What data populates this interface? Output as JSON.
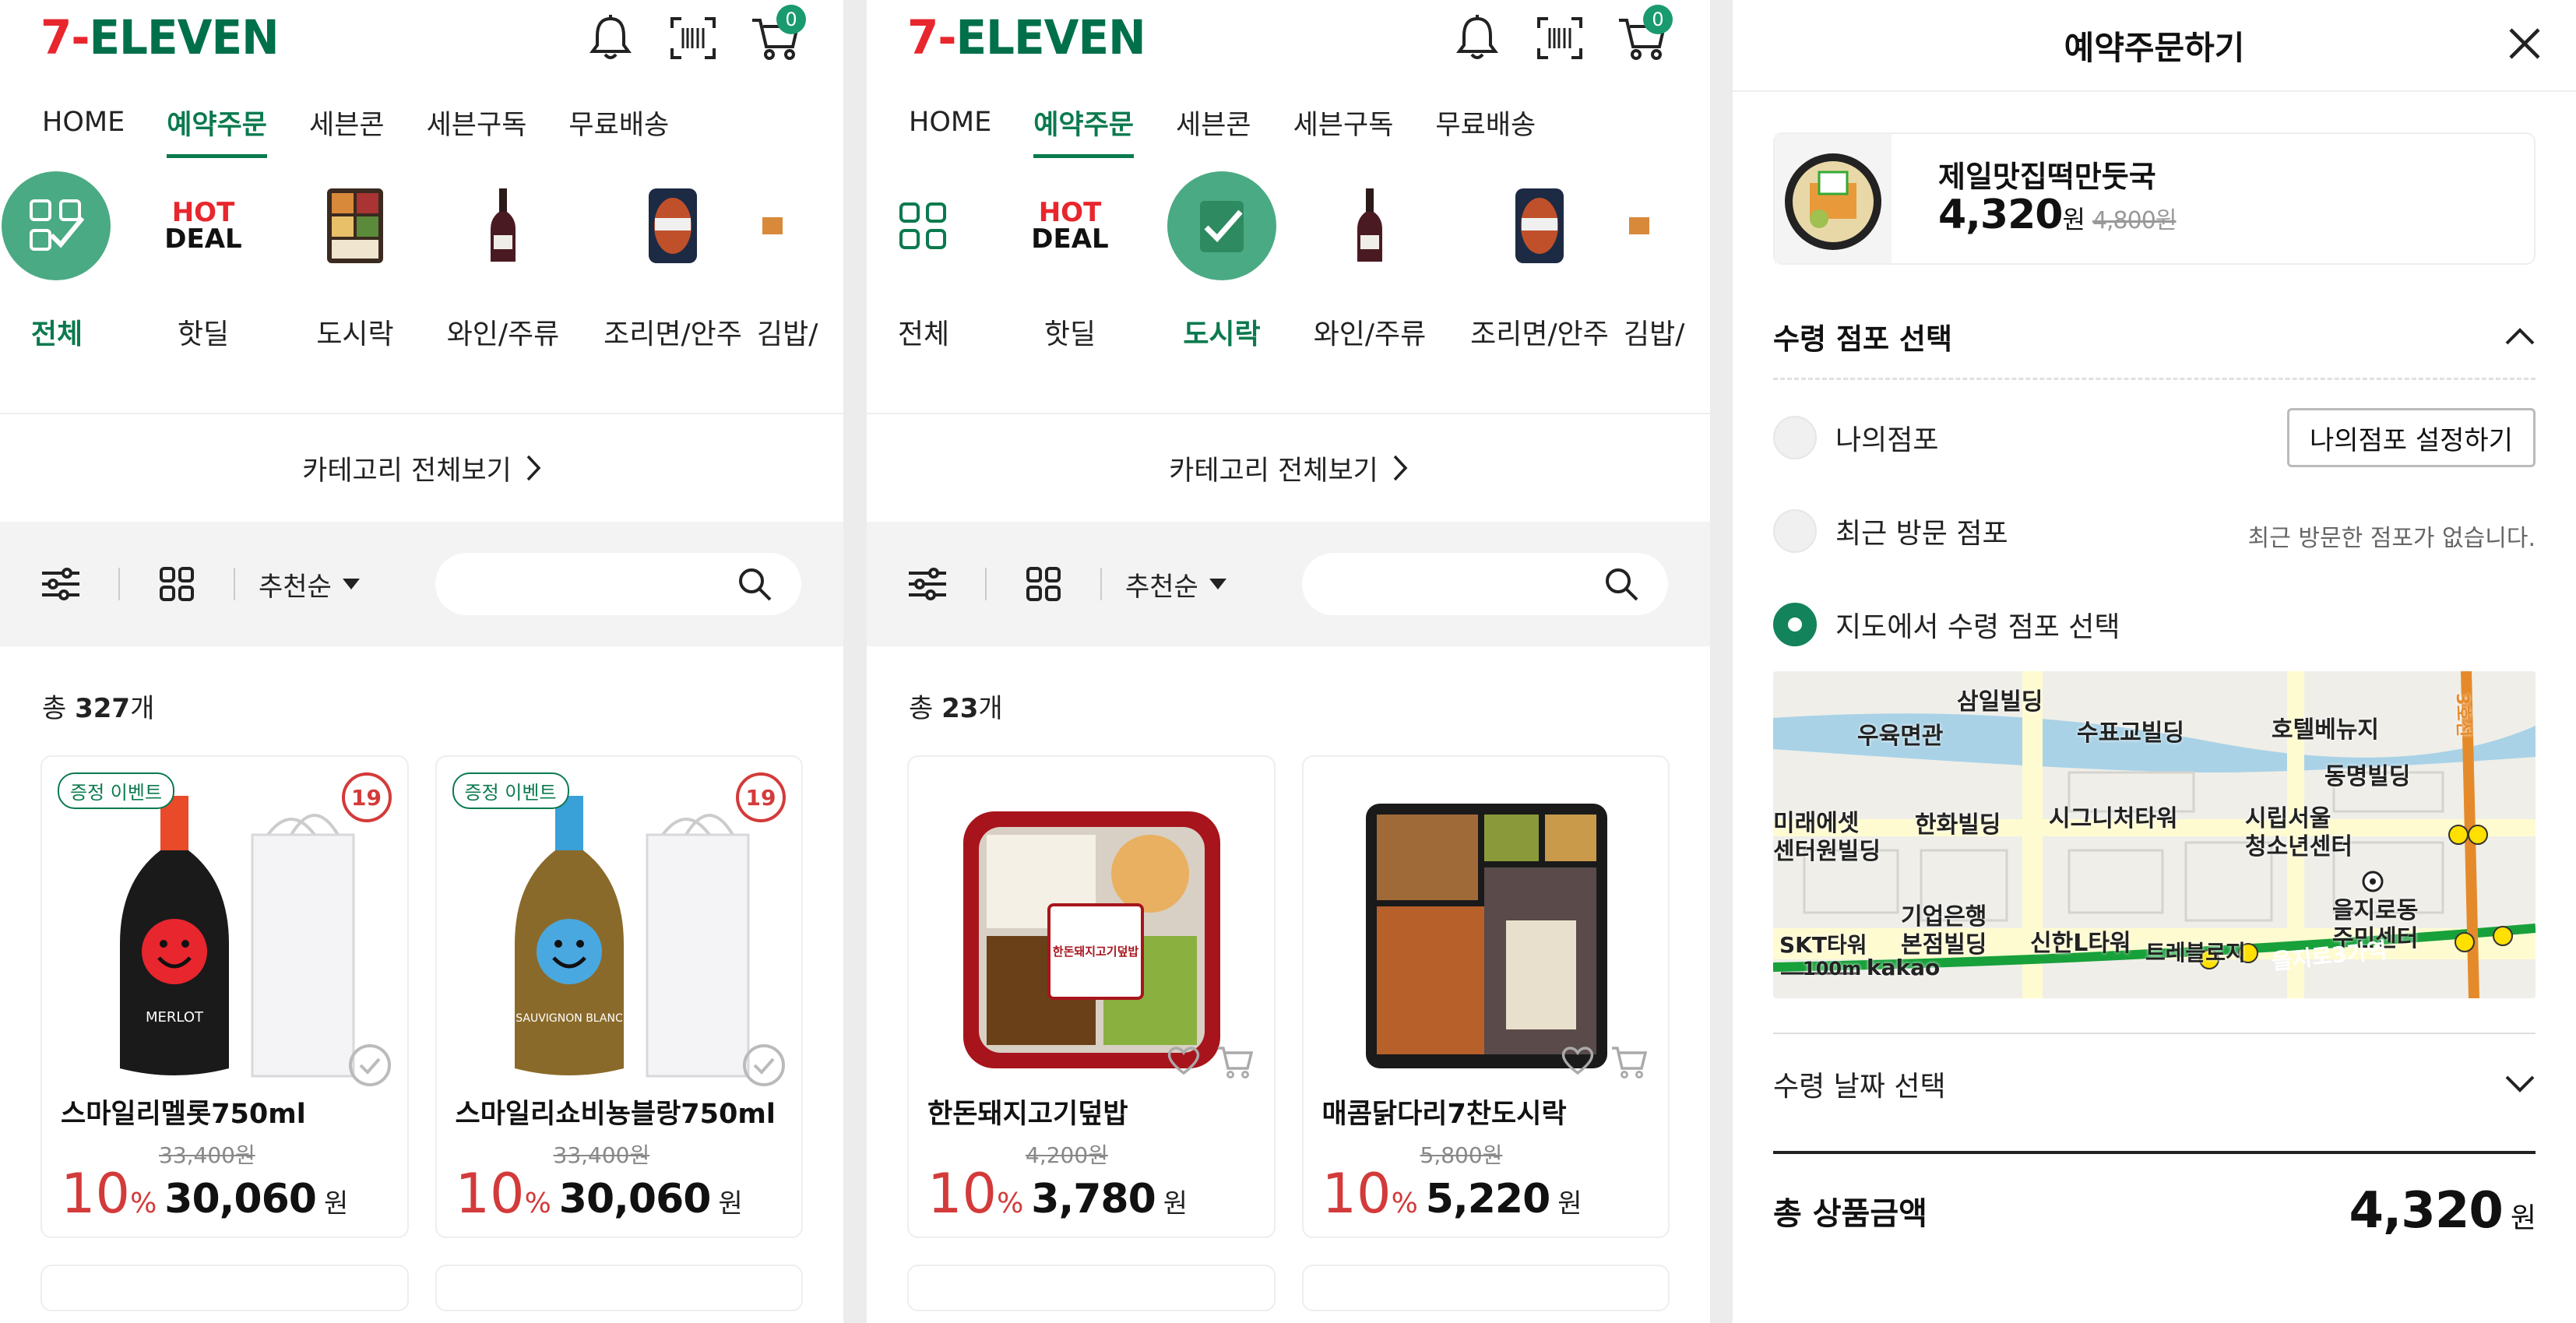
{
  "brand": {
    "logo_num": "7-",
    "logo_word": "ELEVEN",
    "cart_count": "0"
  },
  "nav": [
    "HOME",
    "예약주문",
    "세븐콘",
    "세븐구독",
    "무료배송"
  ],
  "categories": [
    "전체",
    "핫딜",
    "도시락",
    "와인/주류",
    "조리면/안주",
    "김밥/"
  ],
  "hot_deal_text": {
    "hot": "HOT",
    "deal": "DEAL"
  },
  "view_all": "카테고리 전체보기",
  "sort_label": "추천순",
  "screen1": {
    "count_prefix": "총 ",
    "count_num": "327",
    "count_suffix": "개",
    "products": [
      {
        "event": "증정 이벤트",
        "age": "19",
        "name": "스마일리멜롯750ml",
        "orig": "33,400원",
        "pct": "10",
        "price": "30,060",
        "won": "원",
        "bottle_label": "MERLOT"
      },
      {
        "event": "증정 이벤트",
        "age": "19",
        "name": "스마일리쇼비뇽블랑750ml",
        "orig": "33,400원",
        "pct": "10",
        "price": "30,060",
        "won": "원",
        "bottle_label": "SAUVIGNON BLANC"
      }
    ]
  },
  "screen2": {
    "count_prefix": "총 ",
    "count_num": "23",
    "count_suffix": "개",
    "products": [
      {
        "name": "한돈돼지고기덮밥",
        "orig": "4,200원",
        "pct": "10",
        "price": "3,780",
        "won": "원",
        "pkg_label": "한돈돼지고기덮밥"
      },
      {
        "name": "매콤닭다리7찬도시락",
        "orig": "5,800원",
        "pct": "10",
        "price": "5,220",
        "won": "원"
      }
    ]
  },
  "reserve": {
    "title": "예약주문하기",
    "product_name": "제일맛집떡만둣국",
    "price": "4,320",
    "price_unit": "원",
    "orig": "4,800원",
    "store_section": "수령 점포 선택",
    "my_store": "나의점포",
    "my_store_btn": "나의점포 설정하기",
    "recent_store": "최근 방문 점포",
    "recent_note": "최근 방문한 점포가 없습니다.",
    "map_select": "지도에서 수령 점포 선택",
    "map_labels": [
      "삼일빌딩",
      "우육면관",
      "수표교빌딩",
      "호텔베뉴지",
      "동명빌딩",
      "미래에셋",
      "센터원빌딩",
      "한화빌딩",
      "시그니처타워",
      "시립서울",
      "청소년센터",
      "기업은행",
      "본점빌딩",
      "신한L타워",
      "을지로동",
      "주민센터",
      "SKT타워",
      "트레블로지",
      "을지로3가역",
      "3호선",
      "100m",
      "kakao"
    ],
    "date_section": "수령 날짜 선택",
    "total_label": "총 상품금액",
    "total_value": "4,320",
    "total_unit": "원"
  },
  "colors": {
    "brand_green": "#00704a",
    "brand_red": "#e8262d",
    "accent": "#0b7a4e",
    "discount": "#d33a3a"
  }
}
